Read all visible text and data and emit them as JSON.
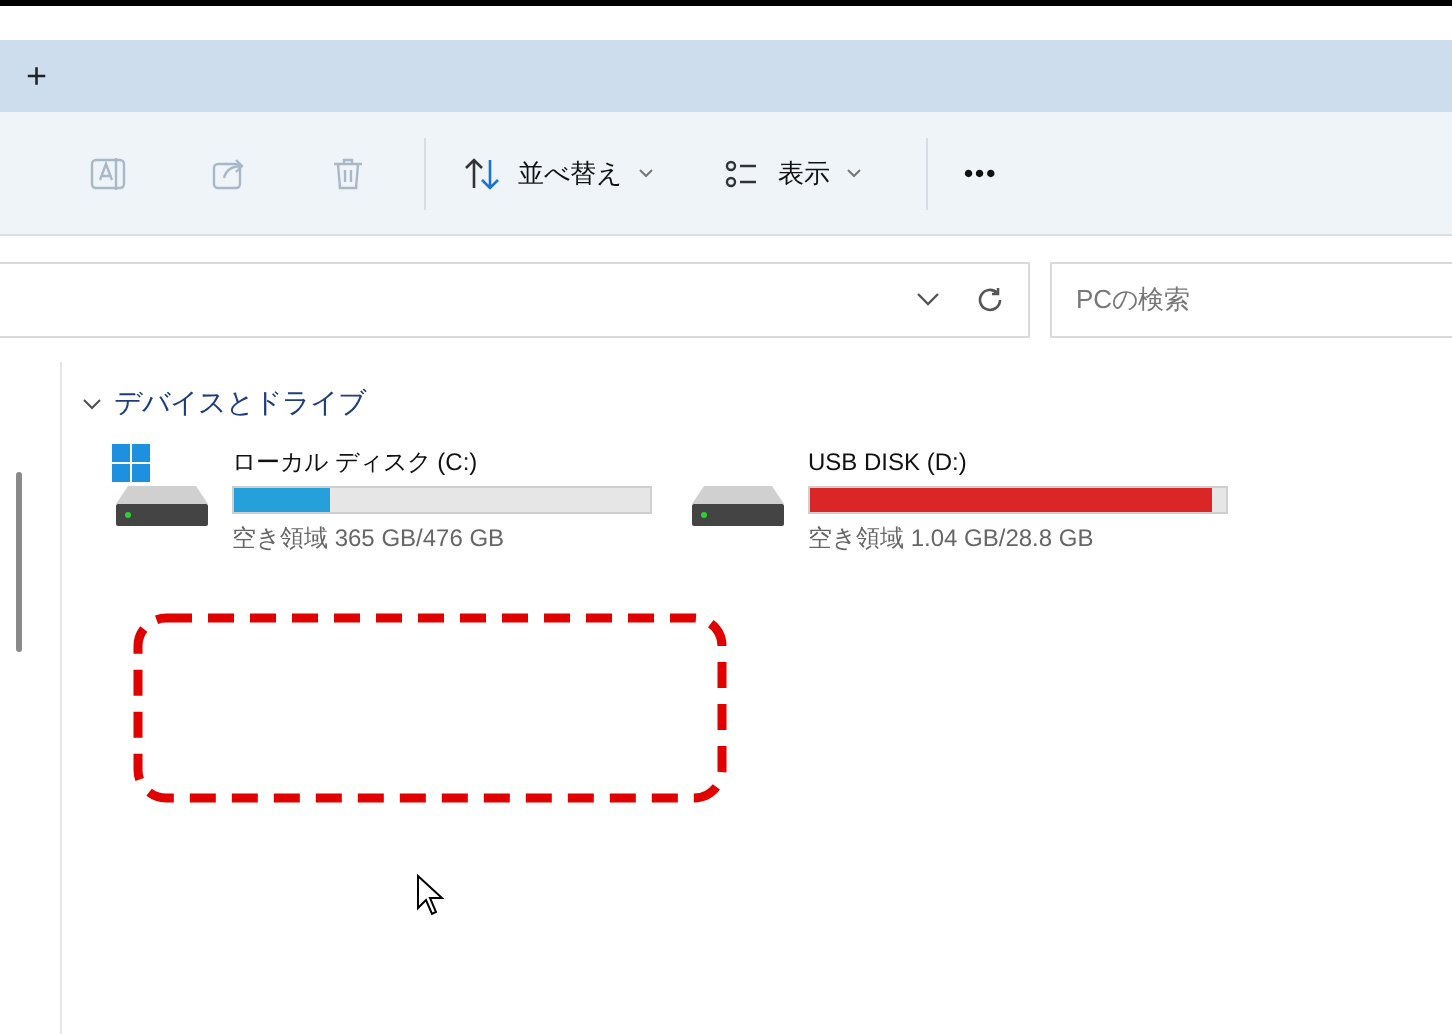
{
  "tab_bar": {
    "new_tab": "+"
  },
  "toolbar": {
    "items": [
      {
        "kind": "rename",
        "disabled": true
      },
      {
        "kind": "share",
        "disabled": true
      },
      {
        "kind": "delete",
        "disabled": true
      },
      {
        "kind": "separator"
      },
      {
        "kind": "sort",
        "label": "並べ替え"
      },
      {
        "kind": "view",
        "label": "表示"
      },
      {
        "kind": "separator"
      },
      {
        "kind": "more",
        "label": "•••"
      }
    ]
  },
  "search": {
    "placeholder": "PCの検索"
  },
  "section": {
    "title": "デバイスとドライブ",
    "expanded": true,
    "drives": [
      {
        "name": "ローカル ディスク (C:)",
        "system": true,
        "level": 0.23,
        "color": "#26a0da",
        "free": "空き領域 365 GB/476 GB"
      },
      {
        "name": "USB DISK (D:)",
        "system": false,
        "level": 0.965,
        "color": "#da2626",
        "free": "空き領域 1.04 GB/28.8 GB"
      }
    ]
  }
}
